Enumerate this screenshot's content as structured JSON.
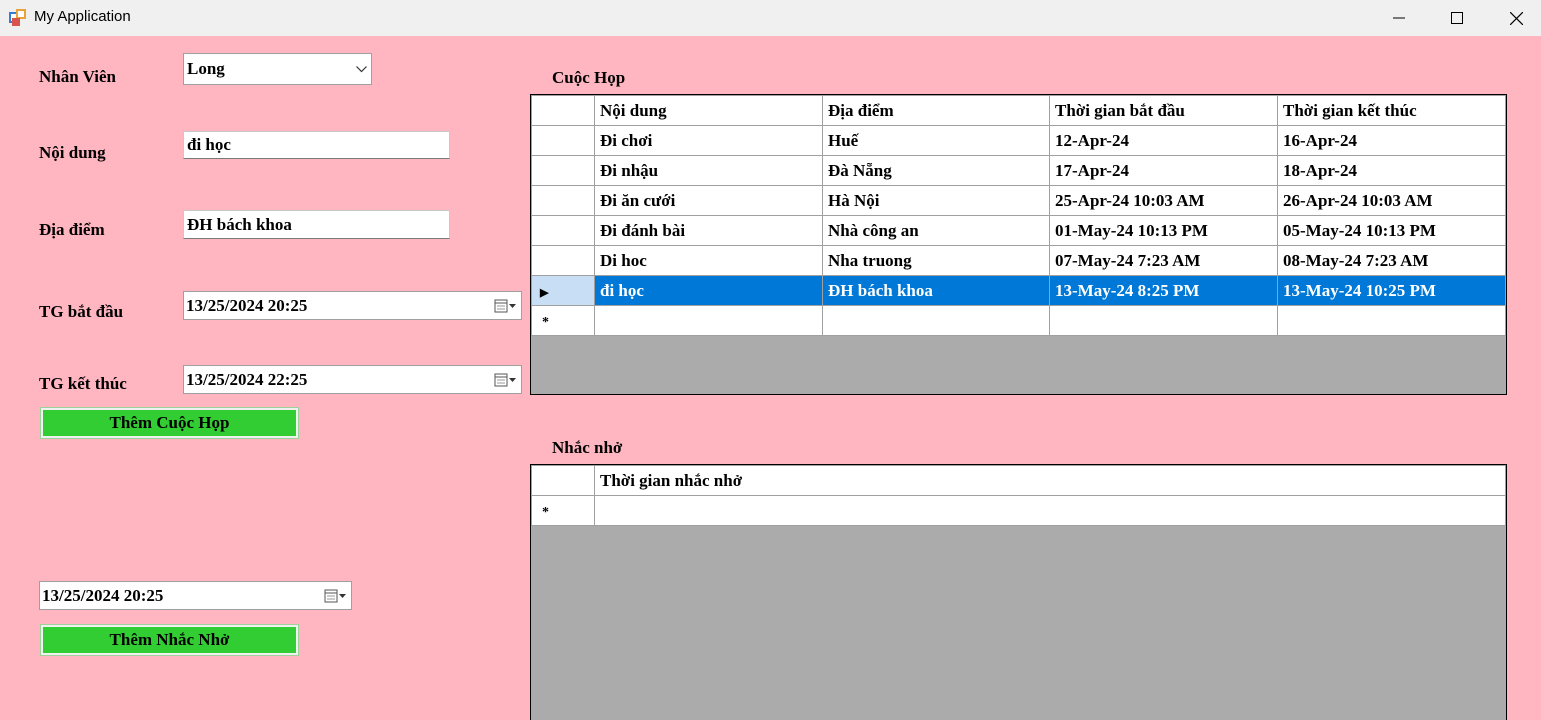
{
  "window": {
    "title": "My Application",
    "minimize_icon": "minimize-icon",
    "maximize_icon": "maximize-icon",
    "close_icon": "close-icon"
  },
  "form": {
    "employee_label": "Nhân Viên",
    "employee_value": "Long",
    "content_label": "Nội dung",
    "content_value": "đi học",
    "location_label": "Địa điểm",
    "location_value": "ĐH bách khoa",
    "start_label": "TG bắt đầu",
    "start_value": "13/25/2024 20:25",
    "end_label": "TG kết thúc",
    "end_value": "13/25/2024 22:25",
    "add_meeting_label": "Thêm Cuộc Họp",
    "reminder_value": "13/25/2024 20:25",
    "add_reminder_label": "Thêm Nhắc Nhở"
  },
  "meetings": {
    "title": "Cuộc Họp",
    "columns": [
      "Nội dung",
      "Địa điểm",
      "Thời gian bắt đầu",
      "Thời gian kết thúc"
    ],
    "rows": [
      [
        "Đi chơi",
        "Huế",
        "12-Apr-24",
        "16-Apr-24"
      ],
      [
        "Đi nhậu",
        "Đà Nẵng",
        "17-Apr-24",
        "18-Apr-24"
      ],
      [
        "Đi ăn cưới",
        "Hà Nội",
        "25-Apr-24 10:03 AM",
        "26-Apr-24 10:03 AM"
      ],
      [
        "Đi đánh bài",
        "Nhà công an",
        "01-May-24 10:13 PM",
        "05-May-24 10:13 PM"
      ],
      [
        "Di hoc",
        "Nha truong",
        "07-May-24 7:23 AM",
        "08-May-24 7:23 AM"
      ],
      [
        "đi học",
        "ĐH bách khoa",
        "13-May-24 8:25 PM",
        "13-May-24 10:25 PM"
      ]
    ],
    "selected_row": 5
  },
  "reminders": {
    "title": "Nhắc nhở",
    "columns": [
      "Thời gian nhắc nhở"
    ],
    "rows": []
  },
  "colors": {
    "background": "#ffb6c1",
    "button": "#32cd32",
    "selection": "#0078d7",
    "grid_empty": "#ababab"
  }
}
